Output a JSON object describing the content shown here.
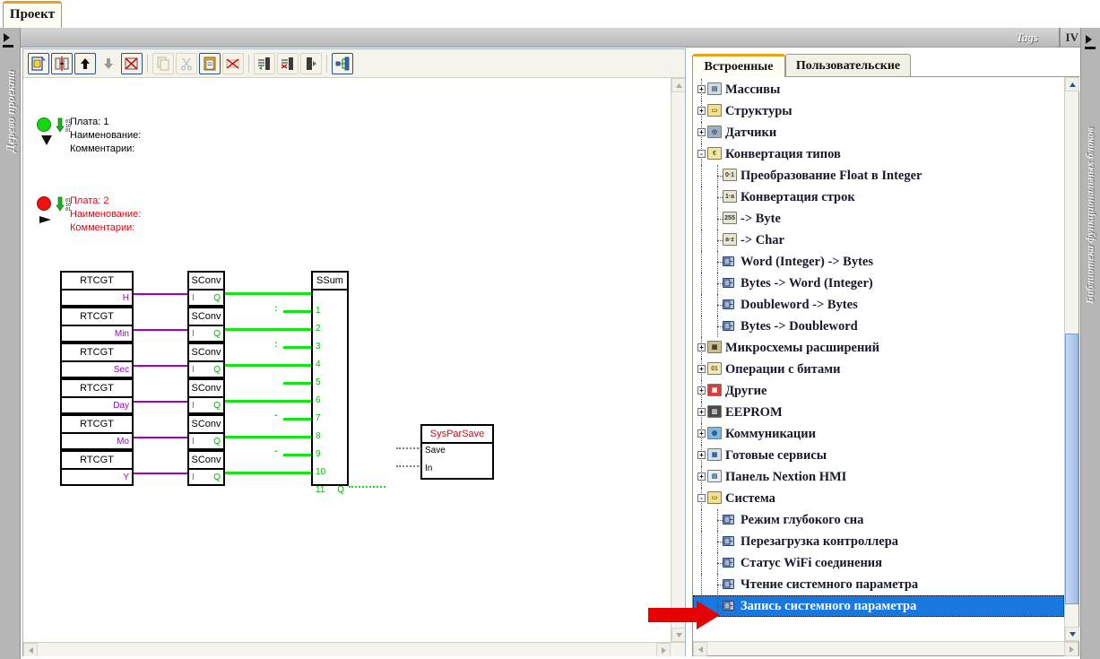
{
  "window": {
    "project_tab": "Проект",
    "tags_label": "Tags",
    "right_edge_marker": "IV",
    "left_dock_label": "Дерево проекта",
    "right_dock_label": "Библиотека функциональных блоков"
  },
  "toolbar": {
    "buttons": [
      {
        "name": "new-page-button",
        "icon": "new-page-icon",
        "state": "framed"
      },
      {
        "name": "split-button",
        "icon": "split-icon",
        "state": "framed"
      },
      {
        "name": "move-up-button",
        "icon": "arrow-up-icon",
        "state": "framed"
      },
      {
        "name": "move-down-button",
        "icon": "arrow-down-icon",
        "state": "framed-disabled"
      },
      {
        "name": "delete-page-button",
        "icon": "delete-page-icon",
        "state": "framed"
      },
      {
        "name": "copy-button",
        "icon": "copy-icon",
        "state": "disabled"
      },
      {
        "name": "cut-button",
        "icon": "scissors-icon",
        "state": "disabled"
      },
      {
        "name": "paste-button",
        "icon": "clipboard-icon",
        "state": "framed"
      },
      {
        "name": "delete-selection-button",
        "icon": "delete-cross-icon",
        "state": "disabled"
      },
      {
        "name": "insert-column-button",
        "icon": "insert-column-icon",
        "state": "flat"
      },
      {
        "name": "remove-column-button",
        "icon": "remove-column-icon",
        "state": "flat"
      },
      {
        "name": "column-properties-button",
        "icon": "column-props-icon",
        "state": "flat"
      },
      {
        "name": "network-view-button",
        "icon": "network-icon",
        "state": "framed"
      }
    ]
  },
  "canvas": {
    "boards": [
      {
        "status": "green",
        "color": "#000000",
        "lines": [
          "Плата: 1",
          "Наименование:",
          "Комментарии:"
        ]
      },
      {
        "status": "red",
        "color": "#e8000f",
        "lines": [
          "Плата: 2",
          "Наименование:",
          "Комментарии:"
        ]
      }
    ],
    "rtcgt_blocks": [
      {
        "title": "RTCGT",
        "pin": "H"
      },
      {
        "title": "RTCGT",
        "pin": "Min"
      },
      {
        "title": "RTCGT",
        "pin": "Sec"
      },
      {
        "title": "RTCGT",
        "pin": "Day"
      },
      {
        "title": "RTCGT",
        "pin": "Mo"
      },
      {
        "title": "RTCGT",
        "pin": "Y"
      }
    ],
    "sconv_blocks": [
      {
        "title": "SConv",
        "in": "I",
        "out": "Q"
      },
      {
        "title": "SConv",
        "in": "I",
        "out": "Q"
      },
      {
        "title": "SConv",
        "in": "I",
        "out": "Q"
      },
      {
        "title": "SConv",
        "in": "I",
        "out": "Q"
      },
      {
        "title": "SConv",
        "in": "I",
        "out": "Q"
      },
      {
        "title": "SConv",
        "in": "I",
        "out": "Q"
      }
    ],
    "ssum_block": {
      "title": "SSum",
      "inputs": [
        "1",
        "2",
        "3",
        "4",
        "5",
        "6",
        "7",
        "8",
        "9",
        "10",
        "11"
      ],
      "output": "Q",
      "constants": [
        ":",
        ":",
        "-",
        "-"
      ]
    },
    "sysparsave_block": {
      "title": "SysParSave",
      "inputs": [
        "Save",
        "In"
      ]
    }
  },
  "library": {
    "tabs": [
      {
        "label": "Встроенные",
        "active": true
      },
      {
        "label": "Пользовательские",
        "active": false
      }
    ],
    "tree": [
      {
        "label": "Массивы",
        "level": 0,
        "expander": "+",
        "icon": "array-icon",
        "selected": false
      },
      {
        "label": "Структуры",
        "level": 0,
        "expander": "+",
        "icon": "structure-icon",
        "selected": false
      },
      {
        "label": "Датчики",
        "level": 0,
        "expander": "+",
        "icon": "sensor-icon",
        "selected": false
      },
      {
        "label": "Конвертация типов",
        "level": 0,
        "expander": "-",
        "icon": "convert-icon",
        "selected": false
      },
      {
        "label": "Преобразование Float в Integer",
        "level": 1,
        "expander": "",
        "icon": "num-convert-icon",
        "selected": false
      },
      {
        "label": "Конвертация строк",
        "level": 1,
        "expander": "",
        "icon": "string-convert-icon",
        "selected": false
      },
      {
        "label": "-> Byte",
        "level": 1,
        "expander": "",
        "icon": "byte-icon",
        "selected": false
      },
      {
        "label": "-> Char",
        "level": 1,
        "expander": "",
        "icon": "char-icon",
        "selected": false
      },
      {
        "label": "Word (Integer) -> Bytes",
        "level": 1,
        "expander": "",
        "icon": "block-icon",
        "selected": false
      },
      {
        "label": "Bytes -> Word (Integer)",
        "level": 1,
        "expander": "",
        "icon": "block-icon",
        "selected": false
      },
      {
        "label": "Doubleword -> Bytes",
        "level": 1,
        "expander": "",
        "icon": "block-icon",
        "selected": false
      },
      {
        "label": "Bytes -> Doubleword",
        "level": 1,
        "expander": "",
        "icon": "block-icon",
        "selected": false
      },
      {
        "label": "Микросхемы расширений",
        "level": 0,
        "expander": "+",
        "icon": "chip-icon",
        "selected": false
      },
      {
        "label": "Операции с битами",
        "level": 0,
        "expander": "+",
        "icon": "bits-icon",
        "selected": false
      },
      {
        "label": "Другие",
        "level": 0,
        "expander": "+",
        "icon": "toolbox-icon",
        "selected": false
      },
      {
        "label": "EEPROM",
        "level": 0,
        "expander": "+",
        "icon": "eeprom-icon",
        "selected": false
      },
      {
        "label": "Коммуникации",
        "level": 0,
        "expander": "+",
        "icon": "globe-icon",
        "selected": false
      },
      {
        "label": "Готовые сервисы",
        "level": 0,
        "expander": "+",
        "icon": "services-icon",
        "selected": false
      },
      {
        "label": "Панель Nextion HMI",
        "level": 0,
        "expander": "+",
        "icon": "hmi-panel-icon",
        "selected": false
      },
      {
        "label": "Система",
        "level": 0,
        "expander": "-",
        "icon": "system-folder-icon",
        "selected": false
      },
      {
        "label": "Режим глубокого сна",
        "level": 1,
        "expander": "",
        "icon": "block-icon",
        "selected": false
      },
      {
        "label": "Перезагрузка контроллера",
        "level": 1,
        "expander": "",
        "icon": "block-icon",
        "selected": false
      },
      {
        "label": "Статус WiFi соединения",
        "level": 1,
        "expander": "",
        "icon": "block-icon",
        "selected": false
      },
      {
        "label": "Чтение системного параметра",
        "level": 1,
        "expander": "",
        "icon": "block-icon",
        "selected": false
      },
      {
        "label": "Запись системного параметра",
        "level": 1,
        "expander": "",
        "icon": "block-icon",
        "selected": true
      }
    ]
  },
  "colors": {
    "accent_orange": "#e8a317",
    "selection_blue": "#1878e0",
    "wire_green": "#13e413",
    "wire_violet": "#a200c0",
    "error_red": "#e8000f",
    "annotation_red": "#e60000"
  }
}
